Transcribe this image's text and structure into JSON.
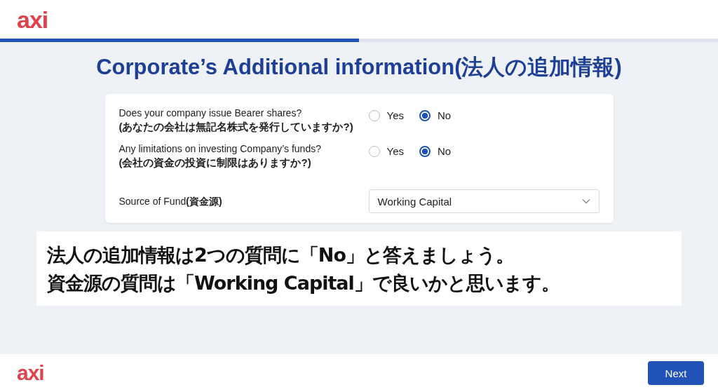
{
  "header": {
    "logo": "axi",
    "progress": {
      "level": 0.5
    }
  },
  "title": "Corporate’s Additional information(法人の追加情報)",
  "questions": [
    {
      "kind": "radio",
      "label": "Does your company issue Bearer shares?",
      "label_ja": "(あなたの会社は無記名株式を発行していますか?)",
      "options": [
        {
          "label": "Yes",
          "selected": false
        },
        {
          "label": "No",
          "selected": true
        }
      ]
    },
    {
      "kind": "radio",
      "label": "Any limitations on investing Company’s funds?",
      "label_ja": "(会社の資金の投資に制限はありますか?)",
      "options": [
        {
          "label": "Yes",
          "selected": false
        },
        {
          "label": "No",
          "selected": true
        }
      ]
    },
    {
      "kind": "select",
      "label": "Source of Fund",
      "label_ja": "(資金源)",
      "value": "Working Capital"
    }
  ],
  "caption": [
    "法人の追加情報は2つの質問に「No」と答えましょう。",
    "資金源の質問は「Working Capital」で良いかと思います。"
  ],
  "footer": {
    "logo": "axi",
    "button": "Next"
  }
}
